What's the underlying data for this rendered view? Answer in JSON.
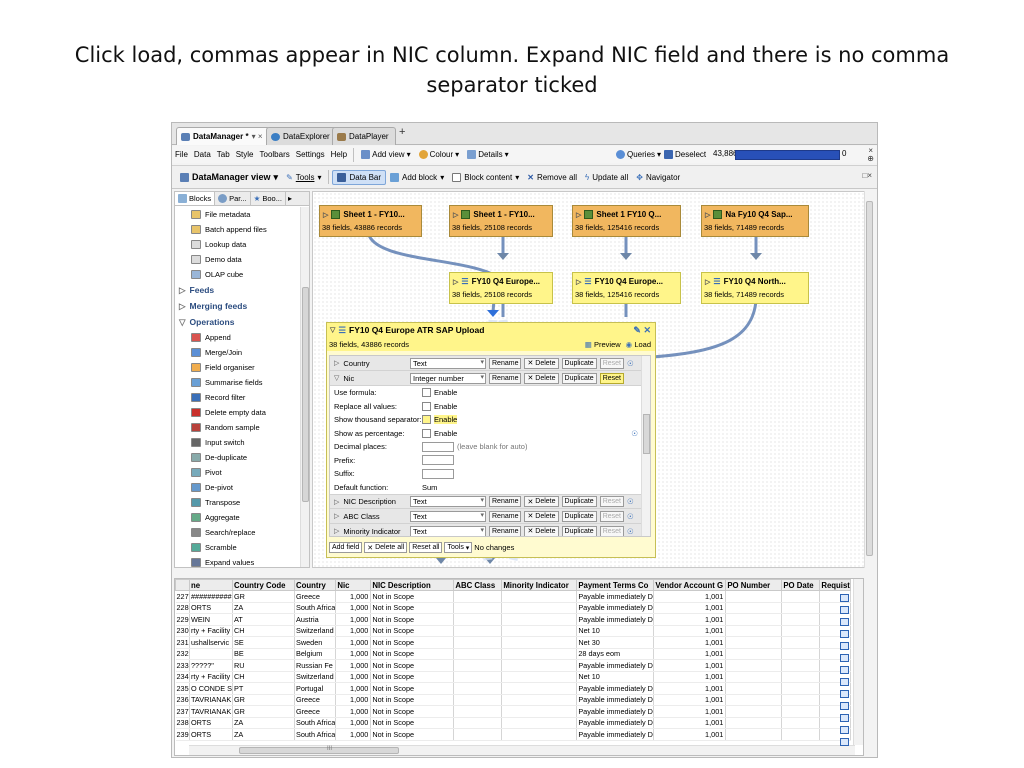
{
  "slide": {
    "title_line1": "Click load, commas appear in NIC column. Expand NIC field and there is no comma",
    "title_line2": "separator ticked"
  },
  "tabs": [
    {
      "label": "DataManager *",
      "icon": "datamanager-icon",
      "color": "#5a7fb5"
    },
    {
      "label": "DataExplorer",
      "icon": "eye-icon",
      "color": "#3b7ec4"
    },
    {
      "label": "DataPlayer",
      "icon": "horse-icon",
      "color": "#9a7a4a"
    }
  ],
  "tab_close": "▾ ×",
  "new_tab": "+",
  "menus": [
    "File",
    "Data",
    "Tab",
    "Style",
    "Toolbars",
    "Settings",
    "Help"
  ],
  "menubar_buttons": {
    "add_view": "Add view",
    "colour": "Colour",
    "details": "Details",
    "queries": "Queries",
    "deselect": "Deselect",
    "count": "43,886",
    "count_end": "0"
  },
  "toolbar": {
    "view": "DataManager view",
    "tools": "Tools",
    "data_bar": "Data Bar",
    "add_block": "Add block",
    "block_content": "Block content",
    "remove_all": "Remove all",
    "update_all": "Update all",
    "navigator": "Navigator"
  },
  "left_panel": {
    "tabs": [
      "Blocks",
      "Par...",
      "Boo..."
    ],
    "items": [
      {
        "label": "File metadata",
        "icon": "folder-icon",
        "type": "item"
      },
      {
        "label": "Batch append files",
        "icon": "folder-icon",
        "type": "item"
      },
      {
        "label": "Lookup data",
        "icon": "table-icon",
        "type": "item"
      },
      {
        "label": "Demo data",
        "icon": "table-icon",
        "type": "item"
      },
      {
        "label": "OLAP cube",
        "icon": "cube-icon",
        "type": "item"
      },
      {
        "label": "Feeds",
        "type": "group",
        "arrow": "▷"
      },
      {
        "label": "Merging feeds",
        "type": "group",
        "arrow": "▷"
      },
      {
        "label": "Operations",
        "type": "group",
        "arrow": "▽"
      },
      {
        "label": "Append",
        "icon": "append-icon",
        "type": "item"
      },
      {
        "label": "Merge/Join",
        "icon": "merge-icon",
        "type": "item"
      },
      {
        "label": "Field organiser",
        "icon": "fields-icon",
        "type": "item"
      },
      {
        "label": "Summarise fields",
        "icon": "summarise-icon",
        "type": "item"
      },
      {
        "label": "Record filter",
        "icon": "filter-icon",
        "type": "item"
      },
      {
        "label": "Delete empty data",
        "icon": "delete-icon",
        "type": "item"
      },
      {
        "label": "Random sample",
        "icon": "dice-icon",
        "type": "item"
      },
      {
        "label": "Input switch",
        "icon": "switch-icon",
        "type": "item"
      },
      {
        "label": "De-duplicate",
        "icon": "dedupe-icon",
        "type": "item"
      },
      {
        "label": "Pivot",
        "icon": "pivot-icon",
        "type": "item"
      },
      {
        "label": "De-pivot",
        "icon": "depivot-icon",
        "type": "item"
      },
      {
        "label": "Transpose",
        "icon": "transpose-icon",
        "type": "item"
      },
      {
        "label": "Aggregate",
        "icon": "aggregate-icon",
        "type": "item"
      },
      {
        "label": "Search/replace",
        "icon": "search-replace-icon",
        "type": "item"
      },
      {
        "label": "Scramble",
        "icon": "scramble-icon",
        "type": "item"
      },
      {
        "label": "Expand values",
        "icon": "expand-icon",
        "type": "item"
      }
    ]
  },
  "blocks": {
    "sheet_a": {
      "title": "Sheet 1 - FY10...",
      "sub": "38 fields, 43886 records"
    },
    "sheet_b": {
      "title": "Sheet 1 - FY10...",
      "sub": "38 fields, 25108 records"
    },
    "sheet_c": {
      "title": "Sheet 1 FY10 Q...",
      "sub": "38 fields, 125416 records"
    },
    "sheet_d": {
      "title": "Na Fy10 Q4 Sap...",
      "sub": "38 fields, 71489 records"
    },
    "org_b": {
      "title": "FY10 Q4 Europe...",
      "sub": "38 fields, 25108 records"
    },
    "org_c": {
      "title": "FY10 Q4 Europe...",
      "sub": "38 fields, 125416 records"
    },
    "org_d": {
      "title": "FY10 Q4 North...",
      "sub": "38 fields, 71489 records"
    }
  },
  "editor": {
    "title": "FY10 Q4 Europe ATR SAP Upload",
    "sub": "38 fields, 43886 records",
    "preview": "Preview",
    "load": "Load",
    "rename": "Rename",
    "delete": "Delete",
    "duplicate": "Duplicate",
    "reset": "Reset",
    "fields_top": [
      {
        "name": "Country",
        "type": "Text",
        "expanded": false
      },
      {
        "name": "Nic",
        "type": "Integer number",
        "expanded": true
      }
    ],
    "options": {
      "use_formula": "Use formula:",
      "replace_all": "Replace all values:",
      "thousand": "Show thousand separator:",
      "percentage": "Show as percentage:",
      "decimal": "Decimal places:",
      "decimal_hint": "(leave blank for auto)",
      "prefix": "Prefix:",
      "suffix": "Suffix:",
      "default_function": "Default function:",
      "enable": "Enable",
      "sum": "Sum"
    },
    "fields_bottom": [
      {
        "name": "NIC Description",
        "type": "Text"
      },
      {
        "name": "ABC Class",
        "type": "Text"
      },
      {
        "name": "Minority Indicator",
        "type": "Text"
      }
    ],
    "footer": {
      "add_field": "Add field",
      "delete_all": "Delete all",
      "reset_all": "Reset all",
      "tools": "Tools",
      "status": "No changes"
    }
  },
  "grid": {
    "columns": [
      "ne",
      "Country Code",
      "Country",
      "Nic",
      "NIC Description",
      "ABC Class",
      "Minority Indicator",
      "Payment Terms Co",
      "Vendor Account G",
      "PO Number",
      "PO Date",
      "Requist"
    ],
    "rows": [
      [
        "227",
        "##########",
        "GR",
        "Greece",
        "1,000",
        "Not in Scope",
        "",
        "",
        "Payable immediately D",
        "1,001",
        "",
        "",
        ""
      ],
      [
        "228",
        "ORTS",
        "ZA",
        "South Africa",
        "1,000",
        "Not in Scope",
        "",
        "",
        "Payable immediately D",
        "1,001",
        "",
        "",
        ""
      ],
      [
        "229",
        "WEIN",
        "AT",
        "Austria",
        "1,000",
        "Not in Scope",
        "",
        "",
        "Payable immediately D",
        "1,001",
        "",
        "",
        ""
      ],
      [
        "230",
        "rty + Facility",
        "CH",
        "Switzerland",
        "1,000",
        "Not in Scope",
        "",
        "",
        "Net 10",
        "1,001",
        "",
        "",
        ""
      ],
      [
        "231",
        "ushallservic",
        "SE",
        "Sweden",
        "1,000",
        "Not in Scope",
        "",
        "",
        "Net 30",
        "1,001",
        "",
        "",
        ""
      ],
      [
        "232",
        "",
        "BE",
        "Belgium",
        "1,000",
        "Not in Scope",
        "",
        "",
        "28 days eom",
        "1,001",
        "",
        "",
        ""
      ],
      [
        "233",
        "?????\"",
        "RU",
        "Russian Fe",
        "1,000",
        "Not in Scope",
        "",
        "",
        "Payable immediately D",
        "1,001",
        "",
        "",
        ""
      ],
      [
        "234",
        "rty + Facility",
        "CH",
        "Switzerland",
        "1,000",
        "Not in Scope",
        "",
        "",
        "Net 10",
        "1,001",
        "",
        "",
        ""
      ],
      [
        "235",
        "O CONDE S",
        "PT",
        "Portugal",
        "1,000",
        "Not in Scope",
        "",
        "",
        "Payable immediately D",
        "1,001",
        "",
        "",
        ""
      ],
      [
        "236",
        "TAVRIANAK",
        "GR",
        "Greece",
        "1,000",
        "Not in Scope",
        "",
        "",
        "Payable immediately D",
        "1,001",
        "",
        "",
        ""
      ],
      [
        "237",
        "TAVRIANAK",
        "GR",
        "Greece",
        "1,000",
        "Not in Scope",
        "",
        "",
        "Payable immediately D",
        "1,001",
        "",
        "",
        ""
      ],
      [
        "238",
        "ORTS",
        "ZA",
        "South Africa",
        "1,000",
        "Not in Scope",
        "",
        "",
        "Payable immediately D",
        "1,001",
        "",
        "",
        ""
      ],
      [
        "239",
        "ORTS",
        "ZA",
        "South Africa",
        "1,000",
        "Not in Scope",
        "",
        "",
        "Payable immediately D",
        "1,001",
        "",
        "",
        ""
      ]
    ],
    "hscroll_label": "III"
  },
  "colors": {
    "orange_block": "#f1b75f",
    "yellow_block": "#fff58a",
    "link_blue": "#4b79c5",
    "progress": "#2850b8"
  }
}
